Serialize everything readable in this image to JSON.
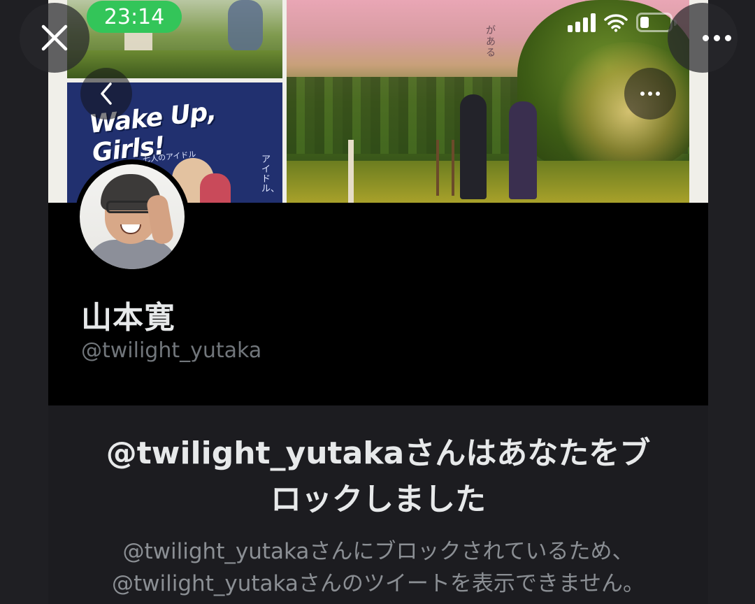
{
  "status_bar": {
    "time": "23:14",
    "time_pill_color": "#33c559",
    "icons": [
      "cellular-signal-icon",
      "wifi-icon",
      "battery-icon"
    ]
  },
  "viewer": {
    "close_icon": "close-icon",
    "more_icon": "more-options-icon"
  },
  "banner": {
    "poster_title": "Wake Up, Girls!",
    "poster_subtitle": "七人のアイドル",
    "poster_vertical_text": "アイドル、",
    "scene_vertical_text": "がある"
  },
  "profile": {
    "display_name": "山本寛",
    "handle": "@twilight_yutaka"
  },
  "blocked": {
    "title_line1": "@twilight_yutakaさんはあなたをブ",
    "title_line2": "ロックしました",
    "body_line1": "@twilight_yutakaさんにブロックされているため、",
    "body_line2": "@twilight_yutakaさんのツイートを表示できません。"
  },
  "colors": {
    "background": "#1f1f23",
    "profile_bg": "#000000",
    "blocked_bg": "#1c1c20",
    "primary_text": "#e7e9ea",
    "secondary_text": "#71767b"
  }
}
